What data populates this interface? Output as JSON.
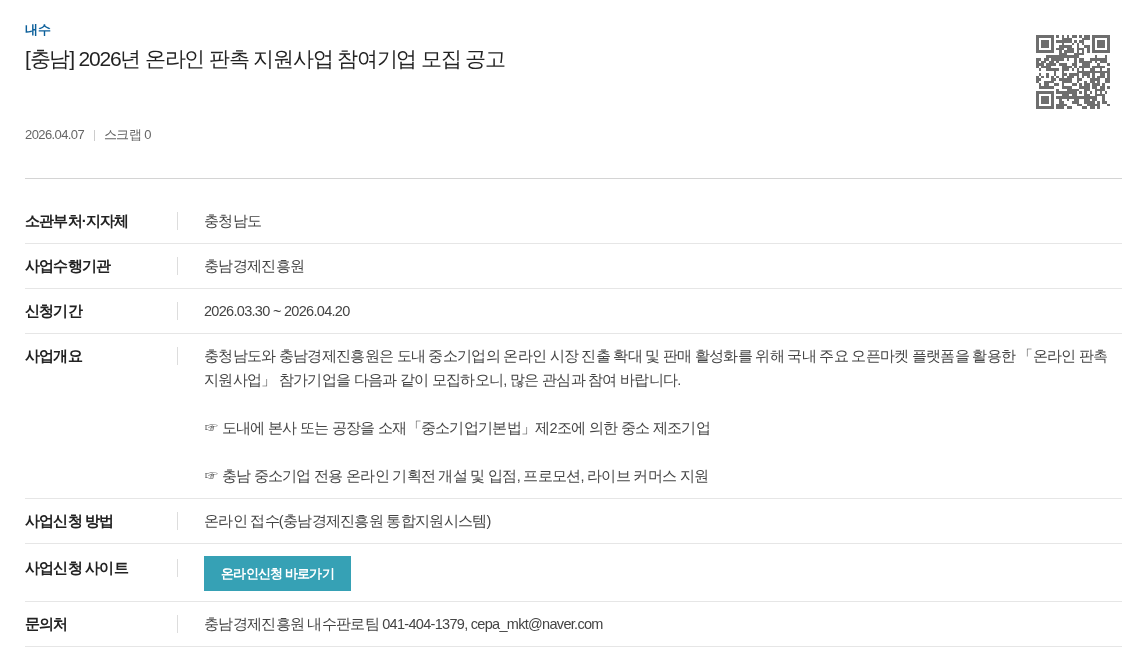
{
  "category": "내수",
  "title": "[충남] 2026년 온라인 판촉 지원사업 참여기업 모집 공고",
  "meta": {
    "date": "2026.04.07",
    "scrap": "스크랩 0"
  },
  "details": [
    {
      "kind": "text",
      "label": "소관부처·지자체",
      "value": "충청남도"
    },
    {
      "kind": "text",
      "label": "사업수행기관",
      "value": "충남경제진흥원"
    },
    {
      "kind": "text",
      "label": "신청기간",
      "value": "2026.03.30 ~ 2026.04.20"
    },
    {
      "kind": "paragraphs",
      "label": "사업개요",
      "paragraphs": [
        "충청남도와 충남경제진흥원은 도내 중소기업의 온라인 시장 진출 확대 및 판매 활성화를 위해 국내 주요 오픈마켓 플랫폼을 활용한 「온라인 판촉 지원사업」 참가기업을 다음과 같이 모집하오니, 많은 관심과 참여 바랍니다.",
        "☞ 도내에 본사 또는 공장을 소재「중소기업기본법」제2조에 의한 중소 제조기업",
        "☞ 충남 중소기업 전용 온라인 기획전 개설 및 입점, 프로모션, 라이브 커머스 지원"
      ]
    },
    {
      "kind": "text",
      "label": "사업신청 방법",
      "value": "온라인 접수(충남경제진흥원 통합지원시스템)"
    },
    {
      "kind": "button",
      "label": "사업신청 사이트",
      "button": "온라인신청 바로가기"
    },
    {
      "kind": "text",
      "label": "문의처",
      "value": "충남경제진흥원 내수판로팀 041-404-1379, cepa_mkt@naver.com"
    }
  ]
}
